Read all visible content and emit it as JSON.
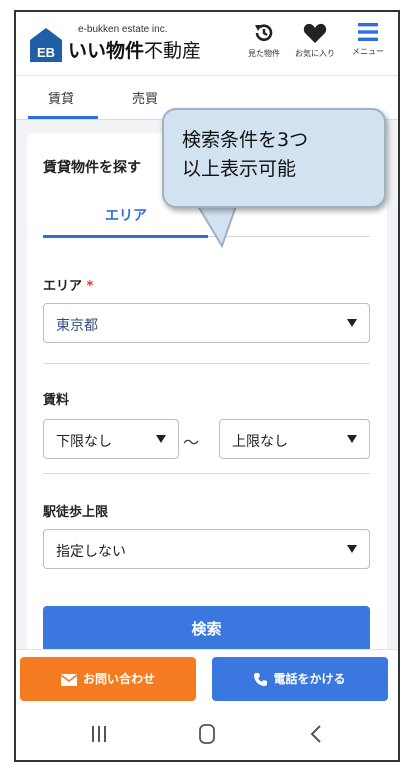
{
  "header": {
    "brand_sub": "e-bukken estate inc.",
    "brand_main_bold": "いい物件",
    "brand_main_rest": "不動産",
    "logo_text": "EB",
    "icons": [
      {
        "name": "history-icon",
        "label": "見た物件"
      },
      {
        "name": "heart-icon",
        "label": "お気に入り"
      },
      {
        "name": "menu-icon",
        "label": "メニュー"
      }
    ],
    "accent_color": "#2f6fdd"
  },
  "tabs": [
    {
      "label": "賃貸",
      "active": true
    },
    {
      "label": "売買",
      "active": false
    }
  ],
  "search_card": {
    "title": "賃貸物件を探す",
    "subtab_active": "エリア",
    "area": {
      "label": "エリア",
      "required_mark": "*",
      "value": "東京都"
    },
    "rent": {
      "label": "賃料",
      "min_value": "下限なし",
      "separator": "〜",
      "max_value": "上限なし"
    },
    "walk": {
      "label": "駅徒歩上限",
      "value": "指定しない"
    },
    "search_button": "検索"
  },
  "tooltip": {
    "line1": "検索条件を3つ",
    "line2": "以上表示可能"
  },
  "bottom_bar": {
    "contact_label": "お問い合わせ",
    "call_label": "電話をかける",
    "contact_color": "#f47b20",
    "call_color": "#3a78e0"
  },
  "nav": {
    "icons": [
      "recent-apps-icon",
      "home-icon",
      "back-icon"
    ]
  }
}
